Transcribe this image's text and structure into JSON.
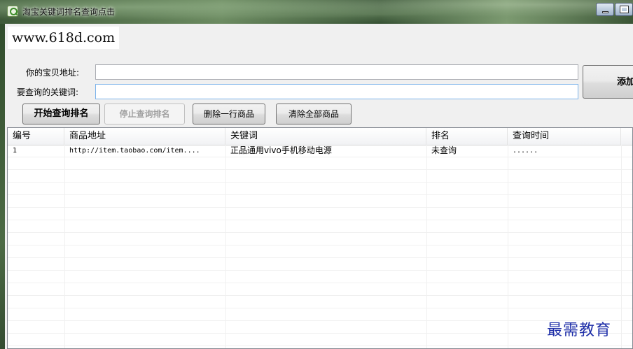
{
  "window": {
    "title": "淘宝关键词排名查询点击",
    "icon": "magnifier-app-icon"
  },
  "site_url": "www.618d.com",
  "form": {
    "item_url_label": "你的宝贝地址:",
    "item_url_value": "",
    "keyword_label": "要查询的关键词:",
    "keyword_value": "",
    "add_label": "添加"
  },
  "toolbar": {
    "start_label": "开始查询排名",
    "stop_label": "停止查询排名",
    "delete_row_label": "删除一行商品",
    "clear_all_label": "清除全部商品"
  },
  "table": {
    "columns": [
      "编号",
      "商品地址",
      "关键词",
      "排名",
      "查询时间"
    ],
    "rows": [
      [
        "1",
        "http://item.taobao.com/item....",
        "正品通用vivo手机移动电源",
        "未查询",
        "......"
      ]
    ]
  },
  "watermark": "最需教育",
  "colors": {
    "watermark": "#1e2ea8",
    "window_bg": "#f0f0f0",
    "grid_border": "#828790"
  }
}
